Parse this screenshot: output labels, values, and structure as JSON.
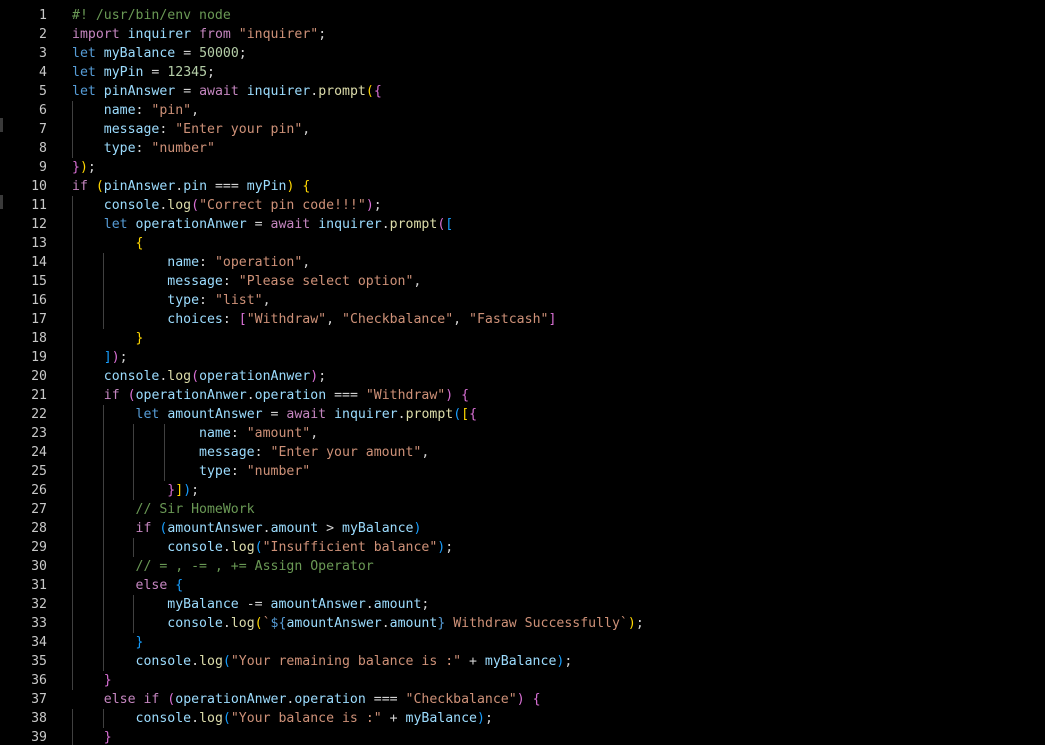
{
  "editor": {
    "lines": [
      {
        "num": "1",
        "tokens": [
          [
            "c",
            "#! /usr/bin/env node"
          ]
        ]
      },
      {
        "num": "2",
        "tokens": [
          [
            "k",
            "import"
          ],
          [
            "o",
            " "
          ],
          [
            "v",
            "inquirer"
          ],
          [
            "o",
            " "
          ],
          [
            "k",
            "from"
          ],
          [
            "o",
            " "
          ],
          [
            "s",
            "\"inquirer\""
          ],
          [
            "o",
            ";"
          ]
        ]
      },
      {
        "num": "3",
        "tokens": [
          [
            "kd",
            "let"
          ],
          [
            "o",
            " "
          ],
          [
            "v",
            "myBalance"
          ],
          [
            "o",
            " = "
          ],
          [
            "n",
            "50000"
          ],
          [
            "o",
            ";"
          ]
        ]
      },
      {
        "num": "4",
        "tokens": [
          [
            "kd",
            "let"
          ],
          [
            "o",
            " "
          ],
          [
            "v",
            "myPin"
          ],
          [
            "o",
            " = "
          ],
          [
            "n",
            "12345"
          ],
          [
            "o",
            ";"
          ]
        ]
      },
      {
        "num": "5",
        "tokens": [
          [
            "kd",
            "let"
          ],
          [
            "o",
            " "
          ],
          [
            "v",
            "pinAnswer"
          ],
          [
            "o",
            " = "
          ],
          [
            "k",
            "await"
          ],
          [
            "o",
            " "
          ],
          [
            "v",
            "inquirer"
          ],
          [
            "o",
            "."
          ],
          [
            "f",
            "prompt"
          ],
          [
            "b1",
            "("
          ],
          [
            "b2",
            "{"
          ]
        ]
      },
      {
        "num": "6",
        "tokens": [
          [
            "o",
            "    "
          ],
          [
            "p",
            "name"
          ],
          [
            "o",
            ": "
          ],
          [
            "s",
            "\"pin\""
          ],
          [
            "o",
            ","
          ]
        ]
      },
      {
        "num": "7",
        "tokens": [
          [
            "o",
            "    "
          ],
          [
            "p",
            "message"
          ],
          [
            "o",
            ": "
          ],
          [
            "s",
            "\"Enter your pin\""
          ],
          [
            "o",
            ","
          ]
        ]
      },
      {
        "num": "8",
        "tokens": [
          [
            "o",
            "    "
          ],
          [
            "p",
            "type"
          ],
          [
            "o",
            ": "
          ],
          [
            "s",
            "\"number\""
          ]
        ]
      },
      {
        "num": "9",
        "tokens": [
          [
            "b2",
            "}"
          ],
          [
            "b1",
            ")"
          ],
          [
            "o",
            ";"
          ]
        ]
      },
      {
        "num": "10",
        "tokens": [
          [
            "k",
            "if"
          ],
          [
            "o",
            " "
          ],
          [
            "b1",
            "("
          ],
          [
            "v",
            "pinAnswer"
          ],
          [
            "o",
            "."
          ],
          [
            "p",
            "pin"
          ],
          [
            "o",
            " === "
          ],
          [
            "v",
            "myPin"
          ],
          [
            "b1",
            ")"
          ],
          [
            "o",
            " "
          ],
          [
            "b1",
            "{"
          ]
        ]
      },
      {
        "num": "11",
        "tokens": [
          [
            "o",
            "    "
          ],
          [
            "v",
            "console"
          ],
          [
            "o",
            "."
          ],
          [
            "f",
            "log"
          ],
          [
            "b2",
            "("
          ],
          [
            "s",
            "\"Correct pin code!!!\""
          ],
          [
            "b2",
            ")"
          ],
          [
            "o",
            ";"
          ]
        ]
      },
      {
        "num": "12",
        "tokens": [
          [
            "o",
            "    "
          ],
          [
            "kd",
            "let"
          ],
          [
            "o",
            " "
          ],
          [
            "v",
            "operationAnwer"
          ],
          [
            "o",
            " = "
          ],
          [
            "k",
            "await"
          ],
          [
            "o",
            " "
          ],
          [
            "v",
            "inquirer"
          ],
          [
            "o",
            "."
          ],
          [
            "f",
            "prompt"
          ],
          [
            "b2",
            "("
          ],
          [
            "b3",
            "["
          ]
        ]
      },
      {
        "num": "13",
        "tokens": [
          [
            "o",
            "        "
          ],
          [
            "b1",
            "{"
          ]
        ]
      },
      {
        "num": "14",
        "tokens": [
          [
            "o",
            "            "
          ],
          [
            "p",
            "name"
          ],
          [
            "o",
            ": "
          ],
          [
            "s",
            "\"operation\""
          ],
          [
            "o",
            ","
          ]
        ]
      },
      {
        "num": "15",
        "tokens": [
          [
            "o",
            "            "
          ],
          [
            "p",
            "message"
          ],
          [
            "o",
            ": "
          ],
          [
            "s",
            "\"Please select option\""
          ],
          [
            "o",
            ","
          ]
        ]
      },
      {
        "num": "16",
        "tokens": [
          [
            "o",
            "            "
          ],
          [
            "p",
            "type"
          ],
          [
            "o",
            ": "
          ],
          [
            "s",
            "\"list\""
          ],
          [
            "o",
            ","
          ]
        ]
      },
      {
        "num": "17",
        "tokens": [
          [
            "o",
            "            "
          ],
          [
            "p",
            "choices"
          ],
          [
            "o",
            ": "
          ],
          [
            "b2",
            "["
          ],
          [
            "s",
            "\"Withdraw\""
          ],
          [
            "o",
            ", "
          ],
          [
            "s",
            "\"Checkbalance\""
          ],
          [
            "o",
            ", "
          ],
          [
            "s",
            "\"Fastcash\""
          ],
          [
            "b2",
            "]"
          ]
        ]
      },
      {
        "num": "18",
        "tokens": [
          [
            "o",
            "        "
          ],
          [
            "b1",
            "}"
          ]
        ]
      },
      {
        "num": "19",
        "tokens": [
          [
            "o",
            "    "
          ],
          [
            "b3",
            "]"
          ],
          [
            "b2",
            ")"
          ],
          [
            "o",
            ";"
          ]
        ]
      },
      {
        "num": "20",
        "tokens": [
          [
            "o",
            "    "
          ],
          [
            "v",
            "console"
          ],
          [
            "o",
            "."
          ],
          [
            "f",
            "log"
          ],
          [
            "b2",
            "("
          ],
          [
            "v",
            "operationAnwer"
          ],
          [
            "b2",
            ")"
          ],
          [
            "o",
            ";"
          ]
        ]
      },
      {
        "num": "21",
        "tokens": [
          [
            "o",
            "    "
          ],
          [
            "k",
            "if"
          ],
          [
            "o",
            " "
          ],
          [
            "b2",
            "("
          ],
          [
            "v",
            "operationAnwer"
          ],
          [
            "o",
            "."
          ],
          [
            "p",
            "operation"
          ],
          [
            "o",
            " === "
          ],
          [
            "s",
            "\"Withdraw\""
          ],
          [
            "b2",
            ")"
          ],
          [
            "o",
            " "
          ],
          [
            "b2",
            "{"
          ]
        ]
      },
      {
        "num": "22",
        "tokens": [
          [
            "o",
            "        "
          ],
          [
            "kd",
            "let"
          ],
          [
            "o",
            " "
          ],
          [
            "v",
            "amountAnswer"
          ],
          [
            "o",
            " = "
          ],
          [
            "k",
            "await"
          ],
          [
            "o",
            " "
          ],
          [
            "v",
            "inquirer"
          ],
          [
            "o",
            "."
          ],
          [
            "f",
            "prompt"
          ],
          [
            "b3",
            "("
          ],
          [
            "b1",
            "["
          ],
          [
            "b2",
            "{"
          ]
        ]
      },
      {
        "num": "23",
        "tokens": [
          [
            "o",
            "                "
          ],
          [
            "p",
            "name"
          ],
          [
            "o",
            ": "
          ],
          [
            "s",
            "\"amount\""
          ],
          [
            "o",
            ","
          ]
        ]
      },
      {
        "num": "24",
        "tokens": [
          [
            "o",
            "                "
          ],
          [
            "p",
            "message"
          ],
          [
            "o",
            ": "
          ],
          [
            "s",
            "\"Enter your amount\""
          ],
          [
            "o",
            ","
          ]
        ]
      },
      {
        "num": "25",
        "tokens": [
          [
            "o",
            "                "
          ],
          [
            "p",
            "type"
          ],
          [
            "o",
            ": "
          ],
          [
            "s",
            "\"number\""
          ]
        ]
      },
      {
        "num": "26",
        "tokens": [
          [
            "o",
            "            "
          ],
          [
            "b2",
            "}"
          ],
          [
            "b1",
            "]"
          ],
          [
            "b3",
            ")"
          ],
          [
            "o",
            ";"
          ]
        ]
      },
      {
        "num": "27",
        "tokens": [
          [
            "o",
            "        "
          ],
          [
            "c",
            "// Sir HomeWork"
          ]
        ]
      },
      {
        "num": "28",
        "tokens": [
          [
            "o",
            "        "
          ],
          [
            "k",
            "if"
          ],
          [
            "o",
            " "
          ],
          [
            "b3",
            "("
          ],
          [
            "v",
            "amountAnswer"
          ],
          [
            "o",
            "."
          ],
          [
            "p",
            "amount"
          ],
          [
            "o",
            " > "
          ],
          [
            "v",
            "myBalance"
          ],
          [
            "b3",
            ")"
          ]
        ]
      },
      {
        "num": "29",
        "tokens": [
          [
            "o",
            "            "
          ],
          [
            "v",
            "console"
          ],
          [
            "o",
            "."
          ],
          [
            "f",
            "log"
          ],
          [
            "b3",
            "("
          ],
          [
            "s",
            "\"Insufficient balance\""
          ],
          [
            "b3",
            ")"
          ],
          [
            "o",
            ";"
          ]
        ]
      },
      {
        "num": "30",
        "tokens": [
          [
            "o",
            "        "
          ],
          [
            "c",
            "// = , -= , += Assign Operator"
          ]
        ]
      },
      {
        "num": "31",
        "tokens": [
          [
            "o",
            "        "
          ],
          [
            "k",
            "else"
          ],
          [
            "o",
            " "
          ],
          [
            "b3",
            "{"
          ]
        ]
      },
      {
        "num": "32",
        "tokens": [
          [
            "o",
            "            "
          ],
          [
            "v",
            "myBalance"
          ],
          [
            "o",
            " -= "
          ],
          [
            "v",
            "amountAnswer"
          ],
          [
            "o",
            "."
          ],
          [
            "p",
            "amount"
          ],
          [
            "o",
            ";"
          ]
        ]
      },
      {
        "num": "33",
        "tokens": [
          [
            "o",
            "            "
          ],
          [
            "v",
            "console"
          ],
          [
            "o",
            "."
          ],
          [
            "f",
            "log"
          ],
          [
            "b1",
            "("
          ],
          [
            "s",
            "`"
          ],
          [
            "sb",
            "${"
          ],
          [
            "v",
            "amountAnswer"
          ],
          [
            "o",
            "."
          ],
          [
            "p",
            "amount"
          ],
          [
            "sb",
            "}"
          ],
          [
            "s",
            " Withdraw Successfully`"
          ],
          [
            "b1",
            ")"
          ],
          [
            "o",
            ";"
          ]
        ]
      },
      {
        "num": "34",
        "tokens": [
          [
            "o",
            "        "
          ],
          [
            "b3",
            "}"
          ]
        ]
      },
      {
        "num": "35",
        "tokens": [
          [
            "o",
            "        "
          ],
          [
            "v",
            "console"
          ],
          [
            "o",
            "."
          ],
          [
            "f",
            "log"
          ],
          [
            "b3",
            "("
          ],
          [
            "s",
            "\"Your remaining balance is :\""
          ],
          [
            "o",
            " + "
          ],
          [
            "v",
            "myBalance"
          ],
          [
            "b3",
            ")"
          ],
          [
            "o",
            ";"
          ]
        ]
      },
      {
        "num": "36",
        "tokens": [
          [
            "o",
            "    "
          ],
          [
            "b2",
            "}"
          ]
        ]
      },
      {
        "num": "37",
        "tokens": [
          [
            "o",
            "    "
          ],
          [
            "k",
            "else if"
          ],
          [
            "o",
            " "
          ],
          [
            "b2",
            "("
          ],
          [
            "v",
            "operationAnwer"
          ],
          [
            "o",
            "."
          ],
          [
            "p",
            "operation"
          ],
          [
            "o",
            " === "
          ],
          [
            "s",
            "\"Checkbalance\""
          ],
          [
            "b2",
            ")"
          ],
          [
            "o",
            " "
          ],
          [
            "b2",
            "{"
          ]
        ]
      },
      {
        "num": "38",
        "tokens": [
          [
            "o",
            "        "
          ],
          [
            "v",
            "console"
          ],
          [
            "o",
            "."
          ],
          [
            "f",
            "log"
          ],
          [
            "b3",
            "("
          ],
          [
            "s",
            "\"Your balance is :\""
          ],
          [
            "o",
            " + "
          ],
          [
            "v",
            "myBalance"
          ],
          [
            "b3",
            ")"
          ],
          [
            "o",
            ";"
          ]
        ]
      },
      {
        "num": "39",
        "tokens": [
          [
            "o",
            "    "
          ],
          [
            "b2",
            "}"
          ]
        ]
      }
    ]
  },
  "colors": {
    "background": "#000000",
    "line_number": "#c8c8c8",
    "indent_guide": "#404040"
  }
}
